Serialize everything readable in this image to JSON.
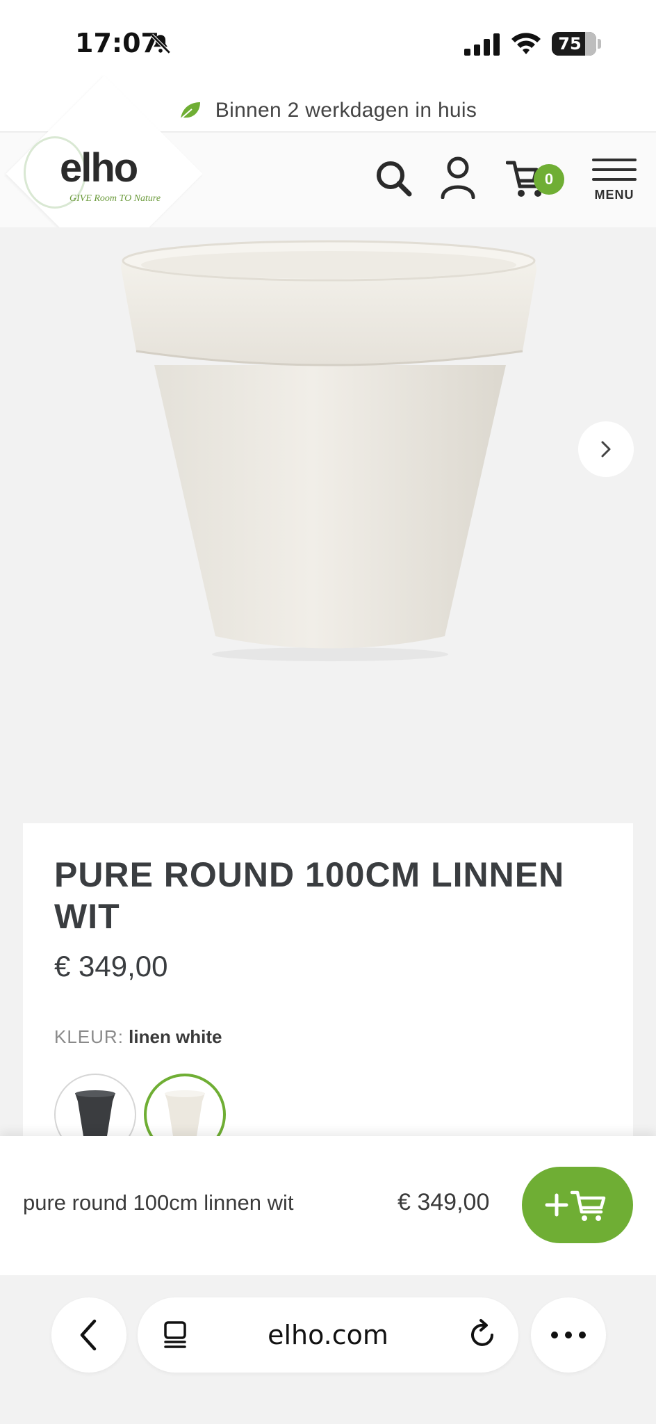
{
  "status_bar": {
    "time": "17:07",
    "battery": "75",
    "battery_level": 0.75
  },
  "banner": {
    "text": "Binnen 2 werkdagen in huis"
  },
  "header": {
    "logo": "elho",
    "tagline": "GIVE Room TO Nature",
    "cart_count": "0",
    "menu_label": "MENU"
  },
  "product": {
    "title": "PURE ROUND 100CM LINNEN WIT",
    "price": "€ 349,00",
    "color_label": "KLEUR:",
    "color_value": "linen white"
  },
  "sticky_bar": {
    "name": "pure round 100cm linnen wit",
    "price": "€ 349,00"
  },
  "browser": {
    "url": "elho.com"
  },
  "colors": {
    "accent": "#6fae34",
    "text": "#3a3d40",
    "background": "#f2f2f2"
  }
}
